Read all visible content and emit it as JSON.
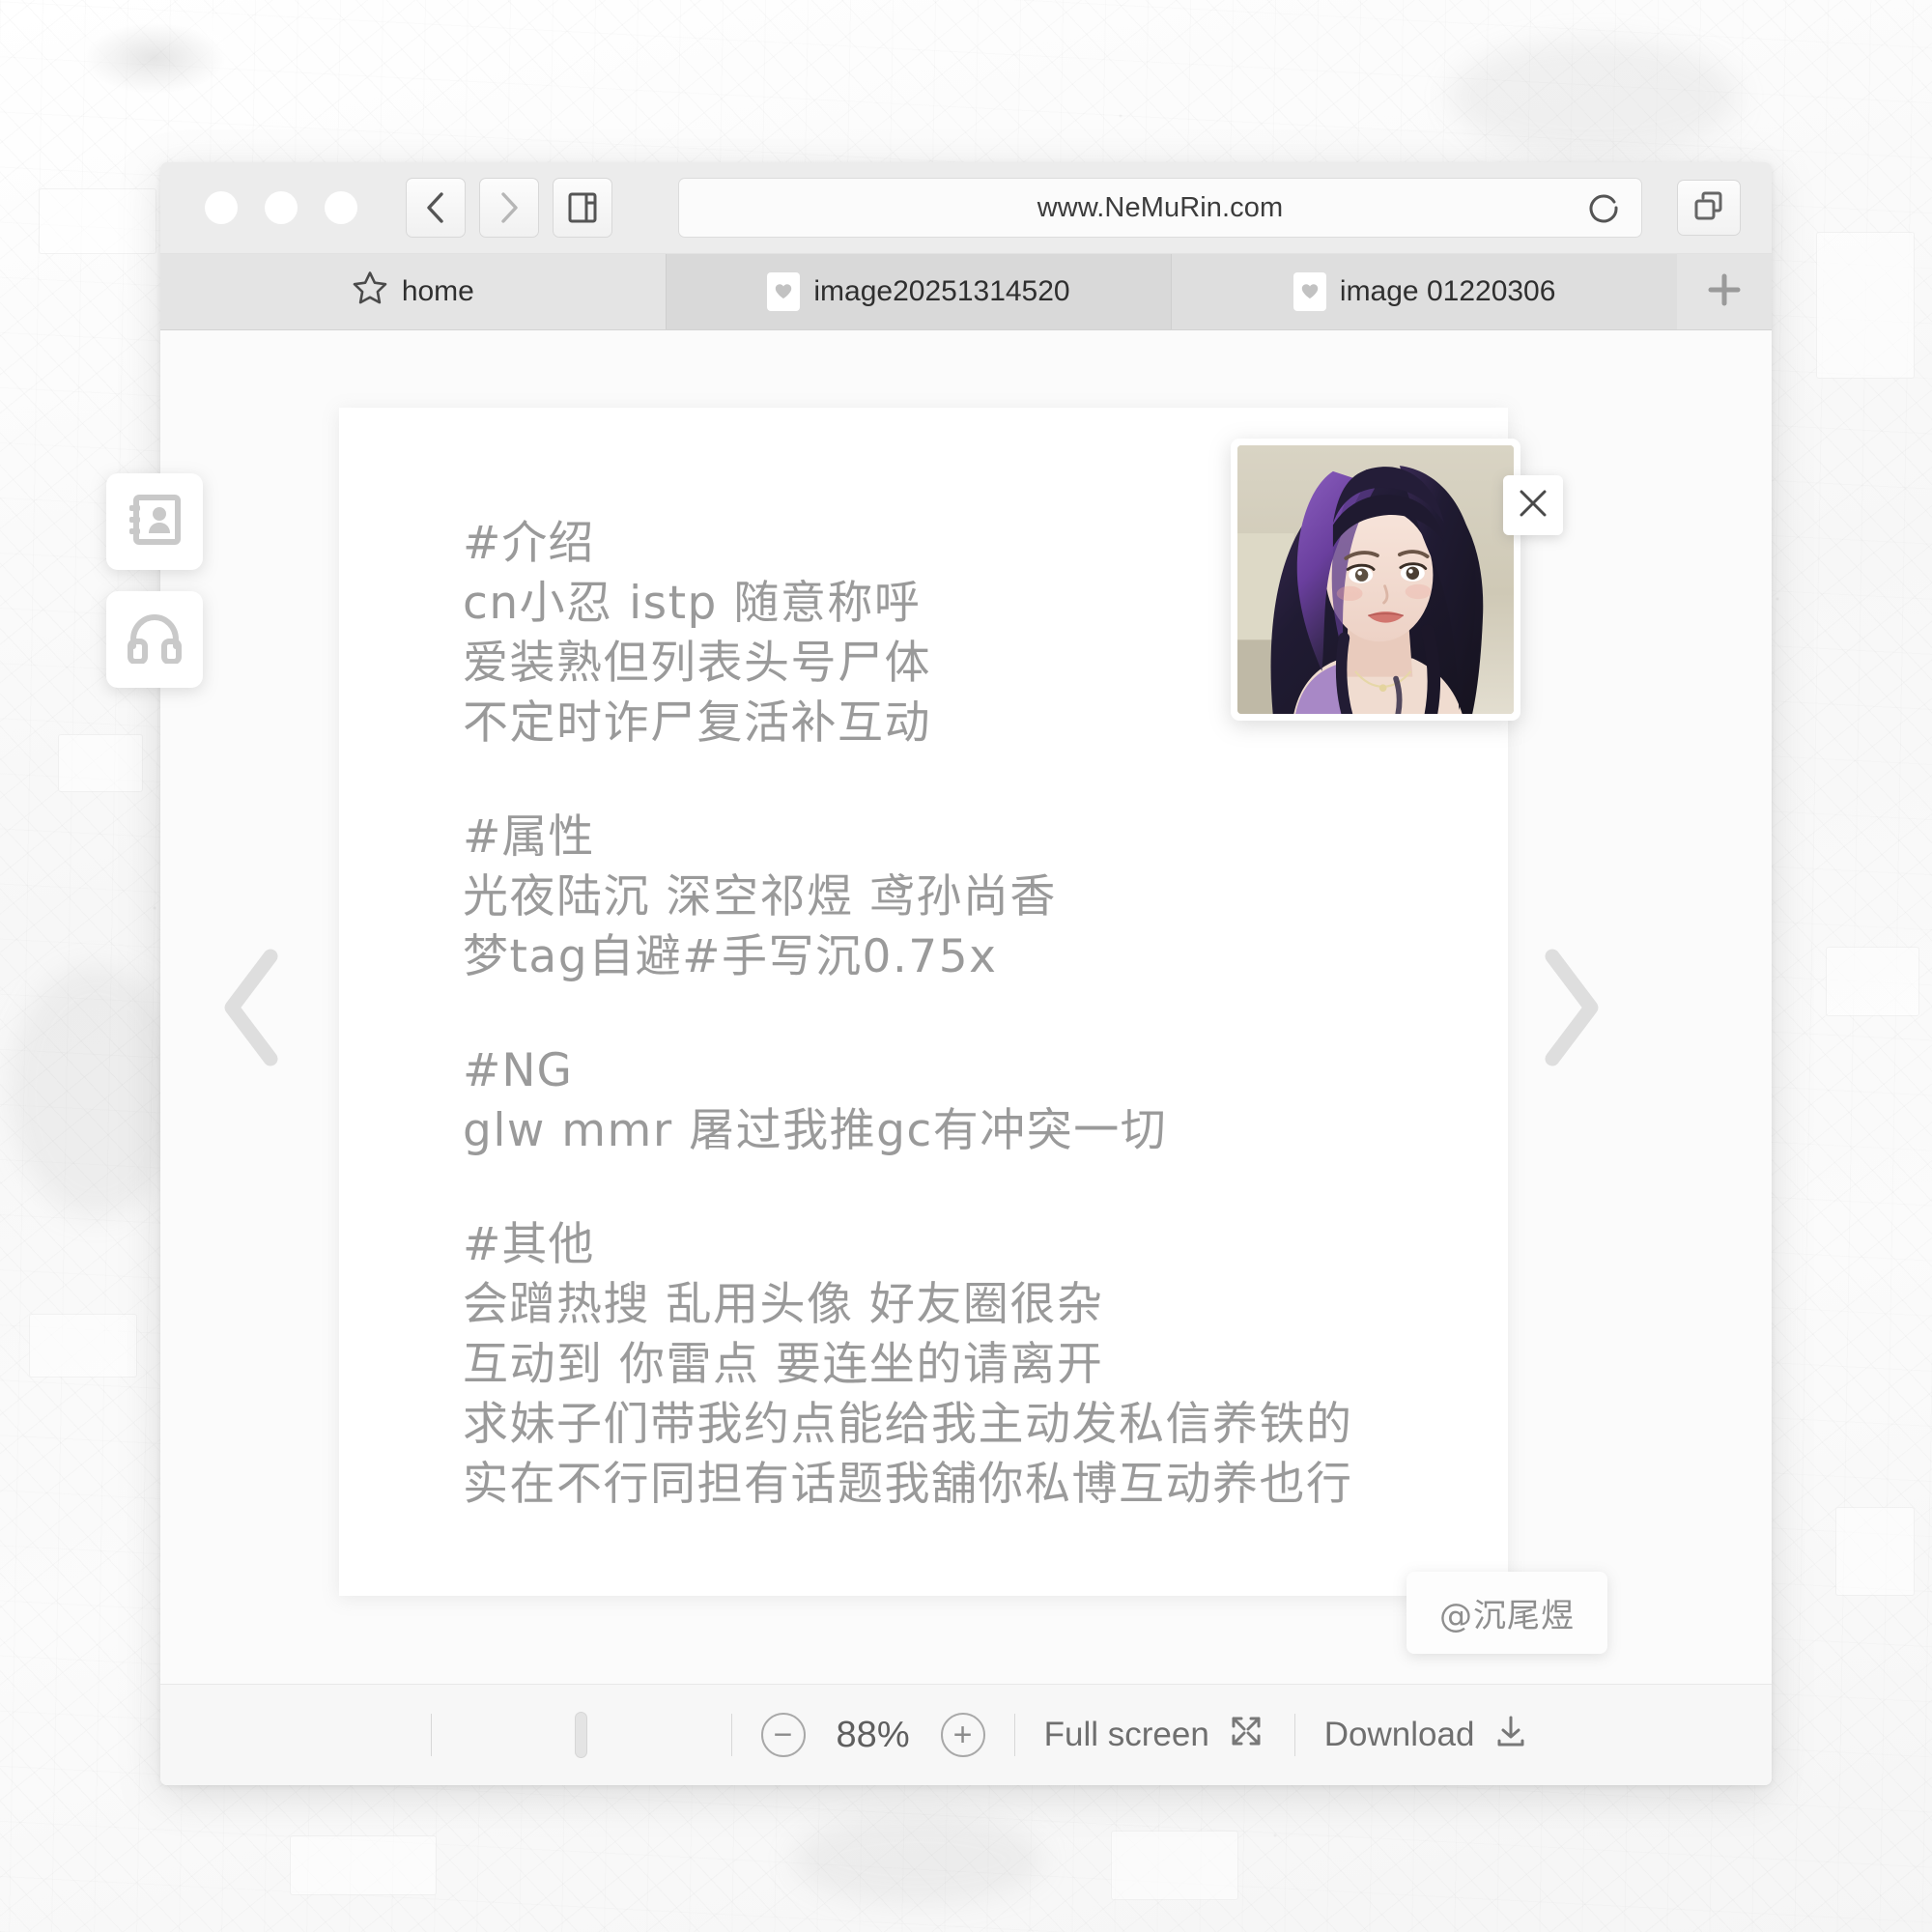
{
  "background": {
    "description": "pale white collage texture"
  },
  "browser": {
    "url": "www.NeMuRin.com",
    "nav": {
      "back_icon": "chevron-left-icon",
      "forward_icon": "chevron-right-icon",
      "sidebar_icon": "sidebar-toggle-icon",
      "reload_icon": "reload-icon",
      "window_stack_icon": "window-stack-icon"
    },
    "tabs": [
      {
        "label": "home",
        "icon": "star-icon",
        "state": "inactive"
      },
      {
        "label": "image20251314520",
        "icon": "heart-icon",
        "state": "active"
      },
      {
        "label": "image 01220306",
        "icon": "heart-icon",
        "state": "current"
      }
    ],
    "new_tab_label": "+"
  },
  "side_dock": {
    "items": [
      {
        "name": "contact-book-icon",
        "label": "Contacts"
      },
      {
        "name": "headphones-icon",
        "label": "Audio"
      }
    ]
  },
  "viewer": {
    "prev_label": "‹",
    "next_label": "›",
    "close_label": "×",
    "watermark": "@沉尾煜"
  },
  "content": {
    "lines": [
      "#介绍",
      "cn小忍 istp 随意称呼",
      "爱装熟但列表头号尸体",
      "不定时诈尸复活补互动",
      "",
      "#属性",
      "光夜陆沉 深空祁煜 鸢孙尚香",
      "梦tag自避#手写沉0.75x",
      "",
      "#NG",
      "glw mmr 屠过我推gc有冲突一切",
      "",
      "#其他",
      "会蹭热搜 乱用头像 好友圈很杂",
      "互动到 你雷点 要连坐的请离开",
      "求妹子们带我约点能给我主动发私信养铁的",
      "实在不行同担有话题我舖你私博互动养也行"
    ]
  },
  "bottom_bar": {
    "zoom_out_label": "−",
    "zoom_value": "88%",
    "zoom_in_label": "+",
    "fullscreen_label": "Full  screen",
    "fullscreen_icon": "expand-icon",
    "download_label": "Download",
    "download_icon": "download-icon"
  },
  "colors": {
    "text_gray": "#9a9a9a",
    "toolbar_gray": "#ececec",
    "tab_active": "#d9d9d9",
    "card_white": "#ffffff"
  }
}
